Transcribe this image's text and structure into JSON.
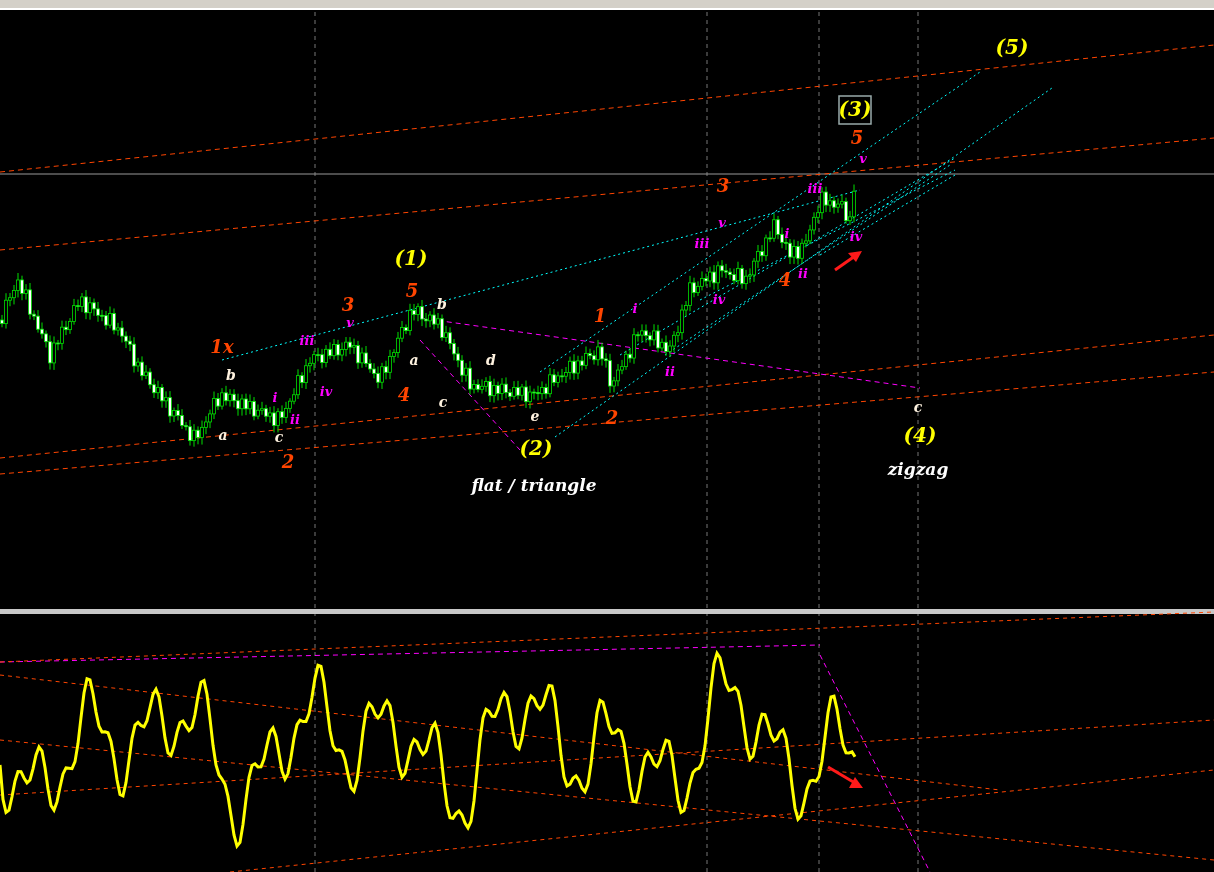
{
  "chart_window": {
    "main_pane": {
      "labels": [
        {
          "text": "(5)",
          "kind": "major",
          "selected": false
        },
        {
          "text": "(3)",
          "kind": "major",
          "selected": true
        },
        {
          "text": "5",
          "kind": "intermediate",
          "selected": false
        },
        {
          "text": "v",
          "kind": "minor",
          "selected": false
        },
        {
          "text": "3",
          "kind": "intermediate",
          "selected": false
        },
        {
          "text": "iii",
          "kind": "minor",
          "selected": false
        },
        {
          "text": "v",
          "kind": "minor",
          "selected": false
        },
        {
          "text": "iii",
          "kind": "minor",
          "selected": false
        },
        {
          "text": "i",
          "kind": "minor",
          "selected": false
        },
        {
          "text": "iv",
          "kind": "minor",
          "selected": false
        },
        {
          "text": "4",
          "kind": "intermediate",
          "selected": false
        },
        {
          "text": "ii",
          "kind": "minor",
          "selected": false
        },
        {
          "text": "iv",
          "kind": "minor",
          "selected": false
        },
        {
          "text": "i",
          "kind": "minor",
          "selected": false
        },
        {
          "text": "1",
          "kind": "intermediate",
          "selected": false
        },
        {
          "text": "ii",
          "kind": "minor",
          "selected": false
        },
        {
          "text": "2",
          "kind": "intermediate",
          "selected": false
        },
        {
          "text": "(1)",
          "kind": "major",
          "selected": false
        },
        {
          "text": "5",
          "kind": "intermediate",
          "selected": false
        },
        {
          "text": "3",
          "kind": "intermediate",
          "selected": false
        },
        {
          "text": "b",
          "kind": "correction",
          "selected": false
        },
        {
          "text": "v",
          "kind": "minor",
          "selected": false
        },
        {
          "text": "iii",
          "kind": "minor",
          "selected": false
        },
        {
          "text": "1x",
          "kind": "intermediate",
          "selected": false
        },
        {
          "text": "b",
          "kind": "correction",
          "selected": false
        },
        {
          "text": "a",
          "kind": "correction",
          "selected": false
        },
        {
          "text": "d",
          "kind": "correction",
          "selected": false
        },
        {
          "text": "iv",
          "kind": "minor",
          "selected": false
        },
        {
          "text": "4",
          "kind": "intermediate",
          "selected": false
        },
        {
          "text": "c",
          "kind": "correction",
          "selected": false
        },
        {
          "text": "i",
          "kind": "minor",
          "selected": false
        },
        {
          "text": "ii",
          "kind": "minor",
          "selected": false
        },
        {
          "text": "e",
          "kind": "correction",
          "selected": false
        },
        {
          "text": "a",
          "kind": "correction",
          "selected": false
        },
        {
          "text": "c",
          "kind": "correction",
          "selected": false
        },
        {
          "text": "2",
          "kind": "intermediate",
          "selected": false
        },
        {
          "text": "(2)",
          "kind": "major",
          "selected": false
        },
        {
          "text": "flat / triangle",
          "kind": "note",
          "selected": false
        },
        {
          "text": "c",
          "kind": "correction",
          "selected": false
        },
        {
          "text": "(4)",
          "kind": "major",
          "selected": false
        },
        {
          "text": "zigzag",
          "kind": "note",
          "selected": false
        }
      ]
    }
  }
}
